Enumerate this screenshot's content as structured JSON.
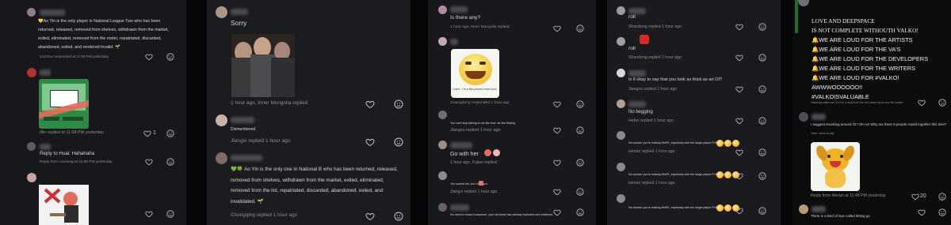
{
  "p1": {
    "c1_text": "💛Ao Yin is the only player in National League Two who has been returned, released, removed from shelves, withdrawn from the market, exiled, eliminated, removed from the roster, repatriated, discarded, abandoned, exiled, and rendered invalid. 🌱",
    "c1_meta": "Guizhou responded at 11:58 PM yesterday.",
    "c2_meta": "Jilin replied at 11:58 PM yesterday",
    "c2_like_count": "1",
    "c3_text": "Reply to Huai: Hahahaha",
    "c3_meta": "Reply from Liaoning at 11:58 PM yesterday"
  },
  "p2": {
    "c1_text": "Sorry",
    "c1_meta": "1 hour ago, Inner Mongolia replied",
    "c2_text": "Dismembered",
    "c2_meta": "Jiangxi replied 1 hour ago",
    "c3_text": "💚🍀 Ao Yin is the only one in National B who has been returned, released, removed from shelves, withdrawn from the market, exiled, eliminated, removed from the list, repatriated, discarded, abandoned, exiled, and invalidated. 🌱",
    "c3_meta": "Chongqing replied 1 hour ago"
  },
  "p3": {
    "c1_text": "Is there any?",
    "c1_meta": "1 hour ago, Inner Mongolia replied.",
    "sticker_caption": "I can't - I'm a five-person mixed you!",
    "c2_meta": "Guangdong responded 1 hour ago",
    "c3_text": "You can't stop talking to me like that, we like Beijing",
    "c3_meta": "Jiangsu replied 1 hour ago",
    "c4_text": "Go with her",
    "c4_meta": "1 hour ago, Fujian replied",
    "c5_text": "You scared me, but I love you",
    "c5_meta": "Jiangxi replied 1 hour ago",
    "c6_text": "No need to thrash it anymore, your old beast has already exploded and shattered."
  },
  "p4": {
    "c1_text": "roll",
    "c1_meta": "Shandong replied 1 hour ago",
    "c2_text": "roll",
    "c2_meta": "Shandong replied 1 hour ago",
    "c3_text": "Is it okay to say that you look as thick as an OI?",
    "c3_meta": "Jiangsu replied 1 hour ago",
    "c4_text": "No begging",
    "c4_meta": "Hebei replied 1 hour ago",
    "c5_text": "No wonder you're making WePK, especially with the single-player PVE mode",
    "c5_meta": "Henan replied 1 hour ago",
    "c6_text": "No wonder you're making WePK, especially with the single-player PVE mode",
    "c6_meta": "Henan replied 1 hour ago",
    "c7_text": "No wonder you're making WePK, especially with the single-player PVE mode"
  },
  "p5": {
    "lines": [
      "LOVE AND DEEPSPACE",
      "IS NOT COMPLETE WITHOUTH VALKO!",
      "🔔WE ARE LOUD FOR THE ARTISTS",
      "🔔WE ARE LOUD FOR THE VA'S",
      "🔔WE ARE LOUD FOR THE DEVELOPERS",
      "🔔WE ARE LOUD FOR THE WRITERS",
      "🔔WE ARE LOUD FOR #VALKO!",
      "AWWWOOOOOO!!",
      "#VALKOISVALUABLE"
    ],
    "c1_meta": "Yesterday afternoon at 5:46, a reply from the Hai sound lab is now live loaded",
    "c2_text": "I suggest revolving around OI? Oh no! Why are there 5 people mixed together this time?",
    "c2_sub": "Yeah, what is pity",
    "c2_meta": "Reply from Henan at 11:48 PM yesterday",
    "c2_like_count": "20",
    "c3_text": "There is a kind of love called letting go"
  }
}
